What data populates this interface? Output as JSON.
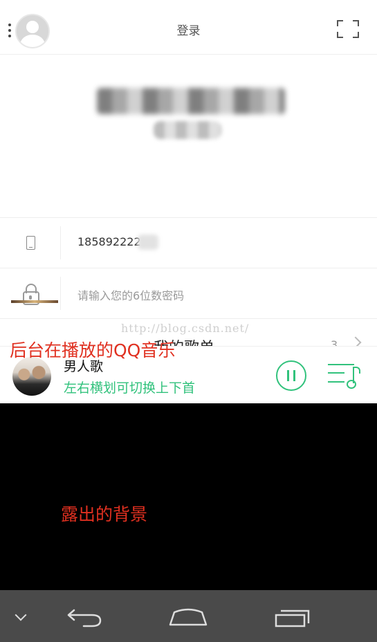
{
  "app": {
    "title": "登录",
    "phone_value": "185892222",
    "password_placeholder": "请输入您的6位数密码",
    "partial_row_text": "我的歌单",
    "partial_row_count": "3"
  },
  "watermark": "http://blog.csdn.net/",
  "annotations": {
    "top": "后台在播放的QQ音乐",
    "bottom": "露出的背景"
  },
  "player": {
    "song": "男人歌",
    "hint": "左右横划可切换上下首"
  },
  "colors": {
    "accent": "#31c27c",
    "annotation": "#e03020",
    "navbar": "#4a4a4a"
  },
  "icons": [
    "menu-dots-icon",
    "avatar-icon",
    "fullscreen-icon",
    "phone-icon",
    "lock-icon",
    "chevron-right-icon",
    "pause-icon",
    "playlist-icon",
    "chevron-down-icon",
    "back-icon",
    "home-icon",
    "recent-apps-icon"
  ]
}
